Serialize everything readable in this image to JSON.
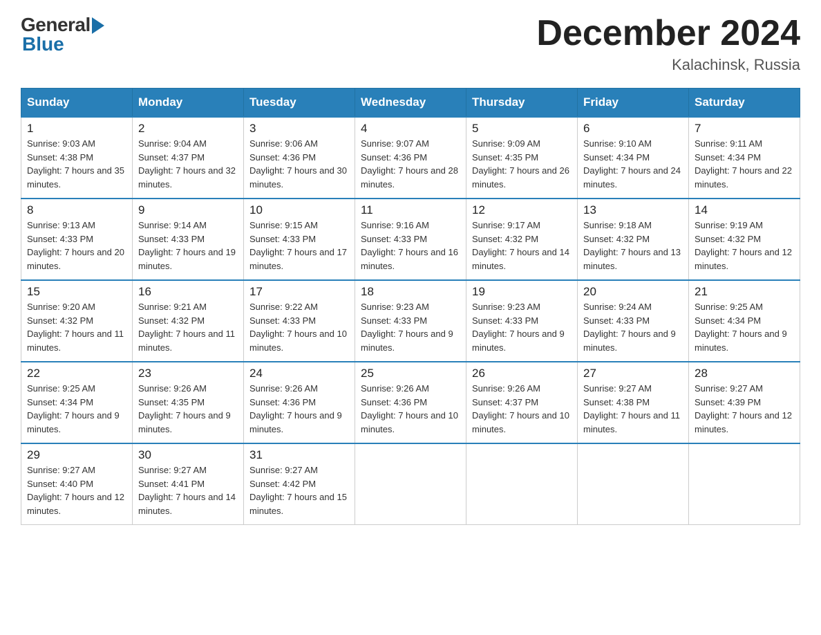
{
  "logo": {
    "general": "General",
    "blue": "Blue"
  },
  "title": "December 2024",
  "location": "Kalachinsk, Russia",
  "days_of_week": [
    "Sunday",
    "Monday",
    "Tuesday",
    "Wednesday",
    "Thursday",
    "Friday",
    "Saturday"
  ],
  "weeks": [
    [
      {
        "day": "1",
        "sunrise": "9:03 AM",
        "sunset": "4:38 PM",
        "daylight": "7 hours and 35 minutes."
      },
      {
        "day": "2",
        "sunrise": "9:04 AM",
        "sunset": "4:37 PM",
        "daylight": "7 hours and 32 minutes."
      },
      {
        "day": "3",
        "sunrise": "9:06 AM",
        "sunset": "4:36 PM",
        "daylight": "7 hours and 30 minutes."
      },
      {
        "day": "4",
        "sunrise": "9:07 AM",
        "sunset": "4:36 PM",
        "daylight": "7 hours and 28 minutes."
      },
      {
        "day": "5",
        "sunrise": "9:09 AM",
        "sunset": "4:35 PM",
        "daylight": "7 hours and 26 minutes."
      },
      {
        "day": "6",
        "sunrise": "9:10 AM",
        "sunset": "4:34 PM",
        "daylight": "7 hours and 24 minutes."
      },
      {
        "day": "7",
        "sunrise": "9:11 AM",
        "sunset": "4:34 PM",
        "daylight": "7 hours and 22 minutes."
      }
    ],
    [
      {
        "day": "8",
        "sunrise": "9:13 AM",
        "sunset": "4:33 PM",
        "daylight": "7 hours and 20 minutes."
      },
      {
        "day": "9",
        "sunrise": "9:14 AM",
        "sunset": "4:33 PM",
        "daylight": "7 hours and 19 minutes."
      },
      {
        "day": "10",
        "sunrise": "9:15 AM",
        "sunset": "4:33 PM",
        "daylight": "7 hours and 17 minutes."
      },
      {
        "day": "11",
        "sunrise": "9:16 AM",
        "sunset": "4:33 PM",
        "daylight": "7 hours and 16 minutes."
      },
      {
        "day": "12",
        "sunrise": "9:17 AM",
        "sunset": "4:32 PM",
        "daylight": "7 hours and 14 minutes."
      },
      {
        "day": "13",
        "sunrise": "9:18 AM",
        "sunset": "4:32 PM",
        "daylight": "7 hours and 13 minutes."
      },
      {
        "day": "14",
        "sunrise": "9:19 AM",
        "sunset": "4:32 PM",
        "daylight": "7 hours and 12 minutes."
      }
    ],
    [
      {
        "day": "15",
        "sunrise": "9:20 AM",
        "sunset": "4:32 PM",
        "daylight": "7 hours and 11 minutes."
      },
      {
        "day": "16",
        "sunrise": "9:21 AM",
        "sunset": "4:32 PM",
        "daylight": "7 hours and 11 minutes."
      },
      {
        "day": "17",
        "sunrise": "9:22 AM",
        "sunset": "4:33 PM",
        "daylight": "7 hours and 10 minutes."
      },
      {
        "day": "18",
        "sunrise": "9:23 AM",
        "sunset": "4:33 PM",
        "daylight": "7 hours and 9 minutes."
      },
      {
        "day": "19",
        "sunrise": "9:23 AM",
        "sunset": "4:33 PM",
        "daylight": "7 hours and 9 minutes."
      },
      {
        "day": "20",
        "sunrise": "9:24 AM",
        "sunset": "4:33 PM",
        "daylight": "7 hours and 9 minutes."
      },
      {
        "day": "21",
        "sunrise": "9:25 AM",
        "sunset": "4:34 PM",
        "daylight": "7 hours and 9 minutes."
      }
    ],
    [
      {
        "day": "22",
        "sunrise": "9:25 AM",
        "sunset": "4:34 PM",
        "daylight": "7 hours and 9 minutes."
      },
      {
        "day": "23",
        "sunrise": "9:26 AM",
        "sunset": "4:35 PM",
        "daylight": "7 hours and 9 minutes."
      },
      {
        "day": "24",
        "sunrise": "9:26 AM",
        "sunset": "4:36 PM",
        "daylight": "7 hours and 9 minutes."
      },
      {
        "day": "25",
        "sunrise": "9:26 AM",
        "sunset": "4:36 PM",
        "daylight": "7 hours and 10 minutes."
      },
      {
        "day": "26",
        "sunrise": "9:26 AM",
        "sunset": "4:37 PM",
        "daylight": "7 hours and 10 minutes."
      },
      {
        "day": "27",
        "sunrise": "9:27 AM",
        "sunset": "4:38 PM",
        "daylight": "7 hours and 11 minutes."
      },
      {
        "day": "28",
        "sunrise": "9:27 AM",
        "sunset": "4:39 PM",
        "daylight": "7 hours and 12 minutes."
      }
    ],
    [
      {
        "day": "29",
        "sunrise": "9:27 AM",
        "sunset": "4:40 PM",
        "daylight": "7 hours and 12 minutes."
      },
      {
        "day": "30",
        "sunrise": "9:27 AM",
        "sunset": "4:41 PM",
        "daylight": "7 hours and 14 minutes."
      },
      {
        "day": "31",
        "sunrise": "9:27 AM",
        "sunset": "4:42 PM",
        "daylight": "7 hours and 15 minutes."
      },
      null,
      null,
      null,
      null
    ]
  ]
}
